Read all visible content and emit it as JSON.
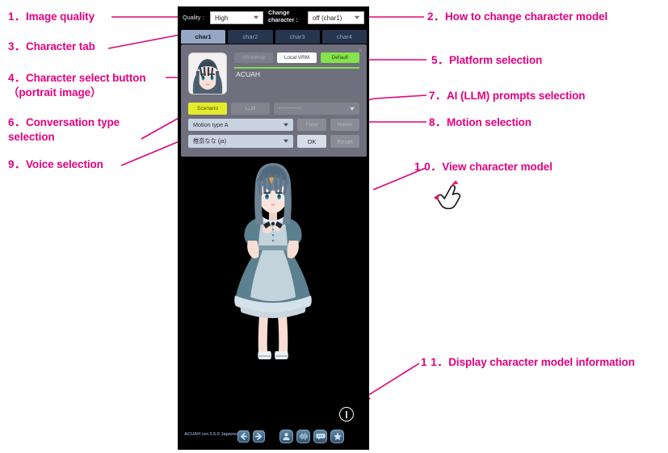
{
  "annotations": [
    {
      "id": 1,
      "num": "1．",
      "text": "Image quality"
    },
    {
      "id": 2,
      "num": "2．",
      "text": "How to change character model"
    },
    {
      "id": 3,
      "num": "3．",
      "text": "Character tab"
    },
    {
      "id": 4,
      "num": "4．",
      "text": "Character select button\n（portrait image）"
    },
    {
      "id": 5,
      "num": "5．",
      "text": "Platform selection"
    },
    {
      "id": 6,
      "num": "6．",
      "text": "Conversation type\nselection"
    },
    {
      "id": 7,
      "num": "7．",
      "text": "AI (LLM) prompts selection"
    },
    {
      "id": 8,
      "num": "8．",
      "text": "Motion selection"
    },
    {
      "id": 9,
      "num": "9．",
      "text": "Voice selection"
    },
    {
      "id": 10,
      "num": "1 0．",
      "text": "View character model"
    },
    {
      "id": 11,
      "num": "1 1．",
      "text": "Display character model information"
    }
  ],
  "app": {
    "topbar": {
      "quality_label": "Quality :",
      "quality_value": "High",
      "change_character_label": "Change\ncharacter :",
      "change_character_value": "off (char1)"
    },
    "tabs": [
      {
        "label": "char1",
        "active": true
      },
      {
        "label": "char2",
        "active": false
      },
      {
        "label": "char3",
        "active": false
      },
      {
        "label": "char4",
        "active": false
      }
    ],
    "card": {
      "close_label": "×",
      "platform_buttons": [
        {
          "label": "VRoidHub",
          "style": "dim"
        },
        {
          "label": "Local VRM",
          "style": "white"
        },
        {
          "label": "Default",
          "style": "green"
        }
      ],
      "model_name": "ACUAH",
      "conversation_buttons": [
        {
          "label": "Scenario",
          "style": "yellow"
        },
        {
          "label": "LLM",
          "style": "dim"
        }
      ],
      "prompt_value": "----------",
      "motion_value": "Motion type A",
      "face_button": "Face",
      "name_button": "Name",
      "voice_value": "椎奈なな (ja)",
      "ok_button": "OK",
      "reset_button": "Reset"
    },
    "stage": {
      "info_button_glyph": "①",
      "version_text": "ACUAH ver.3.5.0\nJapanese",
      "toolbar": [
        {
          "name": "back-arrow-icon"
        },
        {
          "name": "forward-arrow-icon"
        },
        {
          "name": "person-icon"
        },
        {
          "name": "audio-waveform-icon"
        },
        {
          "name": "chat-bubble-icon"
        },
        {
          "name": "star-icon"
        }
      ]
    }
  },
  "colors": {
    "annotation": "#e4007f",
    "accent_green": "#84e24a",
    "accent_yellow": "#e4ec2a",
    "app_background": "#000000",
    "card_background": "#6f6f7d",
    "tab_active": "#95a7c4",
    "tab_inactive": "#27364f"
  }
}
